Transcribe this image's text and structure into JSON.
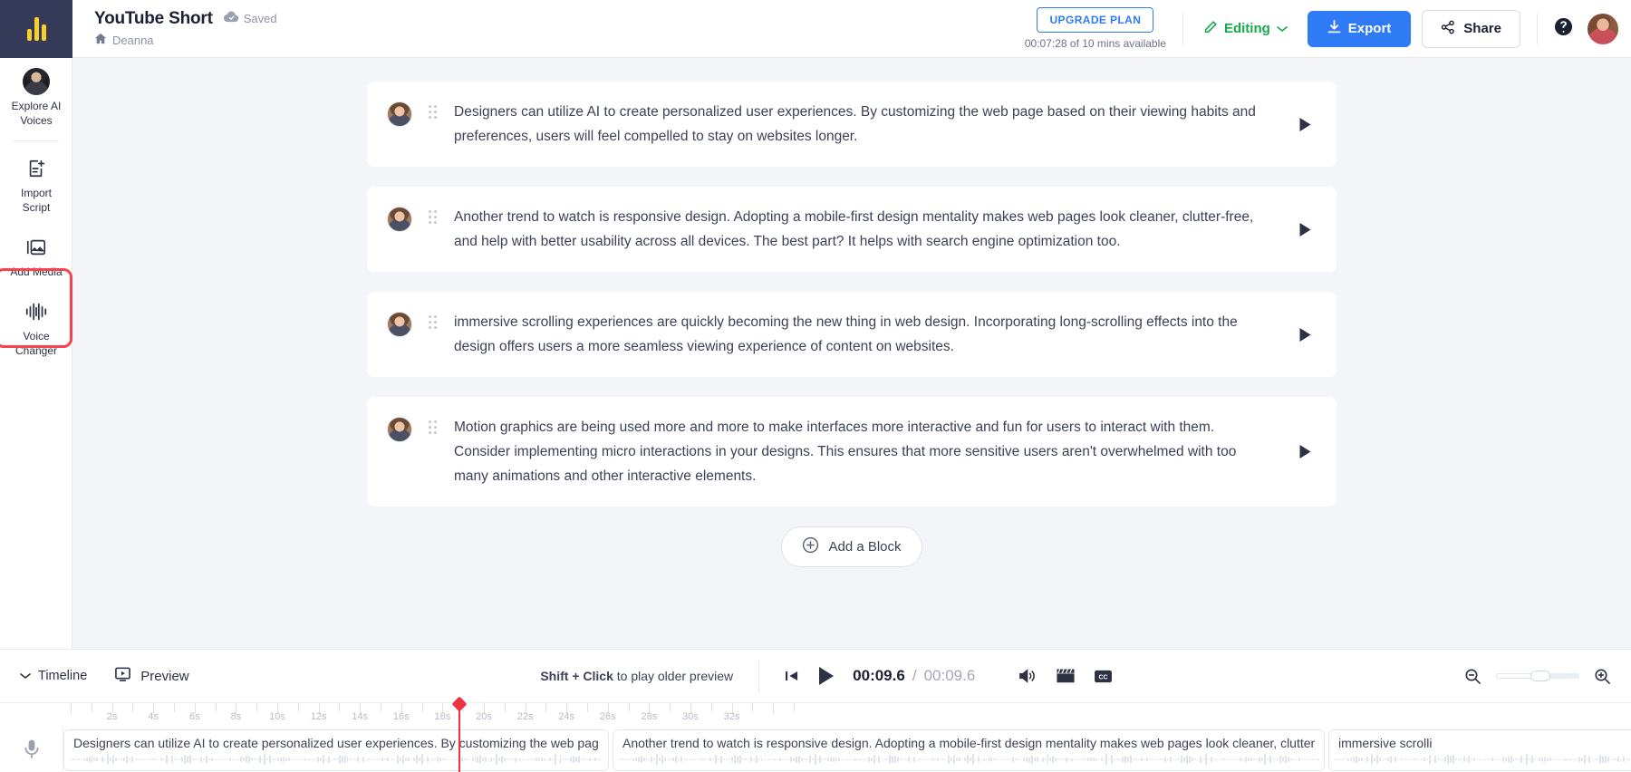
{
  "brand": {
    "logo_name": "murf-logo",
    "rail_bg": "#343a57",
    "accent_yellow": "#f9cf2e"
  },
  "rail": {
    "items": [
      {
        "label_line1": "Explore AI",
        "label_line2": "Voices",
        "icon": "avatar-icon",
        "name": "explore-ai-voices"
      },
      {
        "label_line1": "Import",
        "label_line2": "Script",
        "icon": "import-script-icon",
        "name": "import-script"
      },
      {
        "label_line1": "Add Media",
        "label_line2": "",
        "icon": "add-media-icon",
        "name": "add-media"
      },
      {
        "label_line1": "Voice",
        "label_line2": "Changer",
        "icon": "voice-changer-icon",
        "name": "voice-changer"
      }
    ],
    "highlight_color": "#f9414f",
    "highlighted_item": "Voice Changer"
  },
  "topbar": {
    "project_title": "YouTube Short",
    "saved_label": "Saved",
    "saved_icon": "cloud-check-icon",
    "folder_icon": "home-icon",
    "folder_name": "Deanna",
    "upgrade_label": "UPGRADE PLAN",
    "plan_note": "00:07:28 of 10 mins available",
    "mode_label": "Editing",
    "mode_icon": "pencil-icon",
    "mode_caret": "chevron-down-icon",
    "export_label": "Export",
    "export_icon": "download-icon",
    "share_label": "Share",
    "share_icon": "share-icon",
    "help_icon": "help-circle-icon",
    "avatar_icon": "user-avatar",
    "export_color": "#2f7bf6",
    "editing_color": "#16a94b"
  },
  "script": {
    "blocks": [
      {
        "text": "Designers can utilize AI to create personalized user experiences. By customizing the web page based on their viewing habits and preferences, users will feel compelled to stay on websites longer."
      },
      {
        "text": "Another trend to watch is responsive design. Adopting a mobile-first design mentality makes web pages look cleaner, clutter-free, and help with better usability across all devices. The best part? It helps with search engine optimization too."
      },
      {
        "text": "immersive scrolling experiences are quickly becoming the new thing in web design. Incorporating long-scrolling effects into the design offers users a more seamless viewing experience of content on websites."
      },
      {
        "text": "Motion graphics are being used more and more to make interfaces more interactive and fun for users to interact with them. Consider implementing micro interactions in your designs. This ensures that more sensitive users aren't overwhelmed with too many animations and other interactive elements."
      }
    ],
    "play_icon": "play-icon",
    "grip_icon": "drag-handle-icon",
    "add_block_label": "Add a Block",
    "add_block_icon": "plus-circle-icon"
  },
  "bottom": {
    "timeline_label": "Timeline",
    "timeline_caret": "chevron-down-icon",
    "preview_label": "Preview",
    "preview_icon": "monitor-play-icon",
    "hint_bold": "Shift + Click",
    "hint_rest": " to play older preview",
    "skip_start_icon": "skip-to-start-icon",
    "play_icon": "play-icon",
    "current_time": "00:09.6",
    "separator": "/",
    "total_time": "00:09.6",
    "volume_icon": "volume-icon",
    "clapper_icon": "clapperboard-icon",
    "captions_icon": "closed-captions-icon",
    "zoom_out_icon": "zoom-out-icon",
    "zoom_in_icon": "zoom-in-icon",
    "mic_icon": "microphone-icon"
  },
  "timeline": {
    "tick_labels": [
      "2s",
      "4s",
      "6s",
      "8s",
      "10s",
      "12s",
      "14s",
      "16s",
      "18s",
      "20s",
      "22s",
      "24s",
      "26s",
      "28s",
      "30s",
      "32s"
    ],
    "playhead_color": "#f0333f",
    "playhead_time": "10s",
    "clips": [
      {
        "text": "Designers can utilize AI to create personalized user experiences. By customizing the web pag…"
      },
      {
        "text": "Another trend to watch is responsive design. Adopting a mobile-first design mentality makes web pages look cleaner, clutter-…"
      },
      {
        "text": "immersive scrolli"
      }
    ]
  }
}
